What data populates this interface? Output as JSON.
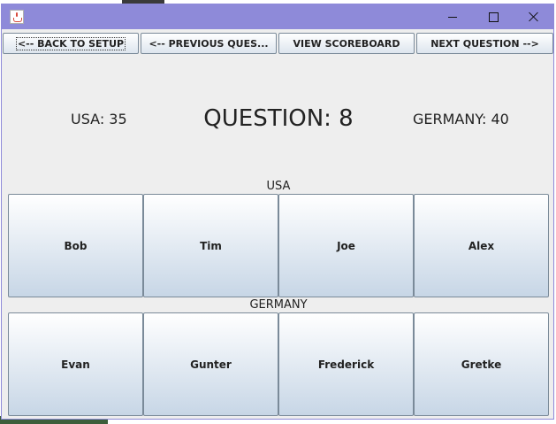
{
  "nav": {
    "back_label": "<-- BACK TO SETUP",
    "previous_label": "<-- PREVIOUS QUES...",
    "scoreboard_label": "VIEW SCOREBOARD",
    "next_label": "NEXT QUESTION -->"
  },
  "scores": {
    "left": "USA: 35",
    "right": "GERMANY: 40"
  },
  "question": "QUESTION: 8",
  "teams": [
    {
      "name": "USA",
      "players": [
        "Bob",
        "Tim",
        "Joe",
        "Alex"
      ]
    },
    {
      "name": "GERMANY",
      "players": [
        "Evan",
        "Gunter",
        "Frederick",
        "Gretke"
      ]
    }
  ],
  "colors": {
    "titlebar": "#8e8ad9",
    "window_bg": "#eeeeee"
  },
  "icons": [
    "java-app-icon",
    "minimize-icon",
    "maximize-icon",
    "close-icon"
  ]
}
